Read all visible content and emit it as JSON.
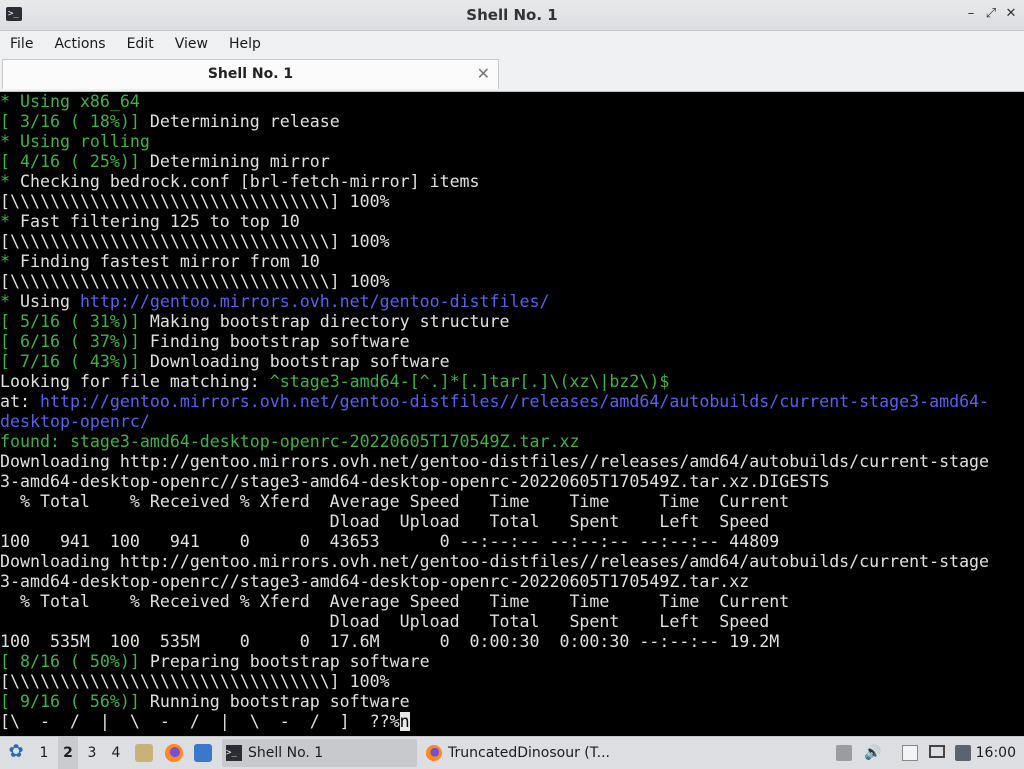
{
  "window": {
    "title": "Shell No. 1",
    "app_icon": "terminal-icon",
    "controls": {
      "minimize": "–",
      "maximize": "⤢",
      "close": "✕"
    }
  },
  "menubar": {
    "items": [
      "File",
      "Actions",
      "Edit",
      "View",
      "Help"
    ]
  },
  "tabs": [
    {
      "label": "Shell No. 1",
      "close": "✕"
    }
  ],
  "terminal": {
    "colors": {
      "green": "#3fb24a",
      "blue": "#5a5ff0",
      "text": "#e0e0e0",
      "background": "#000000"
    },
    "lines": [
      [
        {
          "t": "* Using ",
          "c": "g"
        },
        {
          "t": "x86_64",
          "c": "g"
        }
      ],
      [
        {
          "t": "[ 3/16 ( 18%)]",
          "c": "g"
        },
        {
          "t": " Determining release",
          "c": ""
        }
      ],
      [
        {
          "t": "* Using ",
          "c": "g"
        },
        {
          "t": "rolling",
          "c": "g"
        }
      ],
      [
        {
          "t": "[ 4/16 ( 25%)]",
          "c": "g"
        },
        {
          "t": " Determining mirror",
          "c": ""
        }
      ],
      [
        {
          "t": "* ",
          "c": "g"
        },
        {
          "t": "Checking bedrock.conf [brl-fetch-mirror] items",
          "c": ""
        }
      ],
      [
        {
          "t": "[\\\\\\\\\\\\\\\\\\\\\\\\\\\\\\\\\\\\\\\\\\\\\\\\\\\\\\\\\\\\\\\\] 100%",
          "c": ""
        }
      ],
      [
        {
          "t": "* ",
          "c": "g"
        },
        {
          "t": "Fast filtering 125 to top 10",
          "c": ""
        }
      ],
      [
        {
          "t": "[\\\\\\\\\\\\\\\\\\\\\\\\\\\\\\\\\\\\\\\\\\\\\\\\\\\\\\\\\\\\\\\\] 100%",
          "c": ""
        }
      ],
      [
        {
          "t": "* ",
          "c": "g"
        },
        {
          "t": "Finding fastest mirror from 10",
          "c": ""
        }
      ],
      [
        {
          "t": "[\\\\\\\\\\\\\\\\\\\\\\\\\\\\\\\\\\\\\\\\\\\\\\\\\\\\\\\\\\\\\\\\] 100%",
          "c": ""
        }
      ],
      [
        {
          "t": "* ",
          "c": "g"
        },
        {
          "t": "Using ",
          "c": ""
        },
        {
          "t": "http://gentoo.mirrors.ovh.net/gentoo-distfiles/",
          "c": "b"
        }
      ],
      [
        {
          "t": "[ 5/16 ( 31%)]",
          "c": "g"
        },
        {
          "t": " Making bootstrap directory structure",
          "c": ""
        }
      ],
      [
        {
          "t": "[ 6/16 ( 37%)]",
          "c": "g"
        },
        {
          "t": " Finding bootstrap software",
          "c": ""
        }
      ],
      [
        {
          "t": "[ 7/16 ( 43%)]",
          "c": "g"
        },
        {
          "t": " Downloading bootstrap software",
          "c": ""
        }
      ],
      [
        {
          "t": "Looking for file matching: ",
          "c": ""
        },
        {
          "t": "^stage3-amd64-[^.]*[.]tar[.]\\(xz\\|bz2\\)$",
          "c": "g"
        }
      ],
      [
        {
          "t": "at: ",
          "c": ""
        },
        {
          "t": "http://gentoo.mirrors.ovh.net/gentoo-distfiles//releases/amd64/autobuilds/current-stage3-amd64-",
          "c": "b"
        }
      ],
      [
        {
          "t": "desktop-openrc/",
          "c": "b"
        }
      ],
      [
        {
          "t": "found: ",
          "c": "g"
        },
        {
          "t": "stage3-amd64-desktop-openrc-20220605T170549Z.tar.xz",
          "c": "g"
        }
      ],
      [
        {
          "t": "Downloading http://gentoo.mirrors.ovh.net/gentoo-distfiles//releases/amd64/autobuilds/current-stage",
          "c": ""
        }
      ],
      [
        {
          "t": "3-amd64-desktop-openrc//stage3-amd64-desktop-openrc-20220605T170549Z.tar.xz.DIGESTS",
          "c": ""
        }
      ],
      [
        {
          "t": "  % Total    % Received % Xferd  Average Speed   Time    Time     Time  Current",
          "c": ""
        }
      ],
      [
        {
          "t": "                                 Dload  Upload   Total   Spent    Left  Speed",
          "c": ""
        }
      ],
      [
        {
          "t": "100   941  100   941    0     0  43653      0 --:--:-- --:--:-- --:--:-- 44809",
          "c": ""
        }
      ],
      [
        {
          "t": "Downloading http://gentoo.mirrors.ovh.net/gentoo-distfiles//releases/amd64/autobuilds/current-stage",
          "c": ""
        }
      ],
      [
        {
          "t": "3-amd64-desktop-openrc//stage3-amd64-desktop-openrc-20220605T170549Z.tar.xz",
          "c": ""
        }
      ],
      [
        {
          "t": "  % Total    % Received % Xferd  Average Speed   Time    Time     Time  Current",
          "c": ""
        }
      ],
      [
        {
          "t": "                                 Dload  Upload   Total   Spent    Left  Speed",
          "c": ""
        }
      ],
      [
        {
          "t": "100  535M  100  535M    0     0  17.6M      0  0:00:30  0:00:30 --:--:-- 19.2M",
          "c": ""
        }
      ],
      [
        {
          "t": "[ 8/16 ( 50%)]",
          "c": "g"
        },
        {
          "t": " Preparing bootstrap software",
          "c": ""
        }
      ],
      [
        {
          "t": "[\\\\\\\\\\\\\\\\\\\\\\\\\\\\\\\\\\\\\\\\\\\\\\\\\\\\\\\\\\\\\\\\] 100%",
          "c": ""
        }
      ],
      [
        {
          "t": "[ 9/16 ( 56%)]",
          "c": "g"
        },
        {
          "t": " Running bootstrap software",
          "c": ""
        }
      ],
      [
        {
          "t": "[\\  -  /  |  \\  -  /  |  \\  -  /  ]  ??%",
          "c": ""
        },
        {
          "t": "n",
          "c": "cursor"
        }
      ]
    ]
  },
  "taskbar": {
    "start_icon": "distro-logo-icon",
    "workspaces": [
      "1",
      "2",
      "3",
      "4"
    ],
    "active_workspace": "2",
    "launchers": [
      "file-manager-icon",
      "firefox-icon",
      "desktop-icon"
    ],
    "tasks": [
      {
        "label": "Shell No. 1",
        "icon": "terminal-icon",
        "active": true
      },
      {
        "label": "TruncatedDinosour (T...",
        "icon": "firefox-icon",
        "active": false
      }
    ],
    "tray": [
      "clipboard-icon",
      "volume-icon",
      "notes-icon",
      "display-icon",
      "network-icon"
    ],
    "clock": "16:00"
  }
}
